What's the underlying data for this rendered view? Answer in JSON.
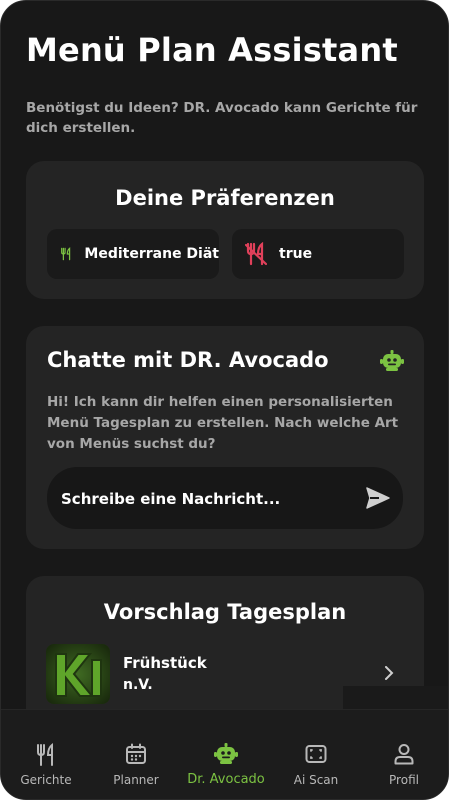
{
  "colors": {
    "accent": "#7cc242",
    "warning": "#e0405a",
    "background": "#181818",
    "card": "#242424"
  },
  "header": {
    "title": "Menü Plan Assistant",
    "subtitle": "Benötigst du Ideen? DR. Avocado kann Gerichte für dich erstellen."
  },
  "preferences": {
    "title": "Deine Präferenzen",
    "chips": [
      {
        "label": "Mediterrane Diät",
        "icon": "fork-knife-icon"
      },
      {
        "label": "true",
        "icon": "no-food-icon"
      }
    ]
  },
  "chat": {
    "title": "Chatte mit DR. Avocado",
    "icon": "bot-icon",
    "message": "Hi! Ich kann dir helfen einen personalisierten Menü Tagesplan zu erstellen. Nach welche Art von Menüs suchst du?",
    "input_placeholder": "Schreibe eine Nachricht...",
    "send_icon": "send-icon"
  },
  "plan": {
    "title": "Vorschlag Tagesplan",
    "meals": [
      {
        "name": "Frühstück",
        "value": "n.V."
      }
    ]
  },
  "nav": {
    "items": [
      {
        "label": "Gerichte",
        "icon": "fork-knife-icon"
      },
      {
        "label": "Planner",
        "icon": "calendar-icon"
      },
      {
        "label": "Dr. Avocado",
        "icon": "bot-icon",
        "active": true
      },
      {
        "label": "Ai Scan",
        "icon": "scan-icon"
      },
      {
        "label": "Profil",
        "icon": "person-icon"
      }
    ]
  }
}
